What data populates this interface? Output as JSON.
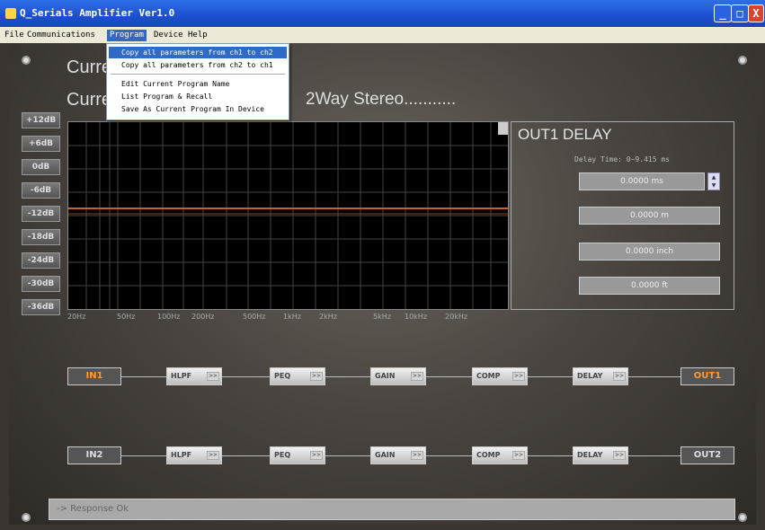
{
  "window": {
    "title": "Q_Serials Amplifier Ver1.0",
    "buttons": {
      "minimize": "_",
      "maximize": "□",
      "close": "X"
    }
  },
  "menu": {
    "items": [
      "File",
      "Communications",
      "Program",
      "Device",
      "Help"
    ],
    "active": "Program"
  },
  "program_menu": {
    "items": [
      "Copy all parameters from ch1 to ch2",
      "Copy all parameters from ch2 to ch1",
      "Edit Current Program Name",
      "List Program & Recall",
      "Save As Current Program In Device"
    ]
  },
  "header": {
    "current_label_1": "Curre",
    "current_label_2": "Curre",
    "program_name": "2Way Stereo..........."
  },
  "gain_buttons": [
    "+12dB",
    "+6dB",
    "0dB",
    "-6dB",
    "-12dB",
    "-18dB",
    "-24dB",
    "-30dB",
    "-36dB"
  ],
  "frequency_labels": [
    "20Hz",
    "50Hz",
    "100Hz",
    "200Hz",
    "500Hz",
    "1kHz",
    "2kHz",
    "5kHz",
    "10kHz",
    "20kHz"
  ],
  "delay": {
    "title": "OUT1 DELAY",
    "hint": "Delay Time: 0~9.415 ms",
    "ms": "0.0000 ms",
    "m": "0.0000 m",
    "inch": "0.0000 inch",
    "ft": "0.0000 ft"
  },
  "chain1": {
    "input": "IN1",
    "output": "OUT1",
    "modules": [
      "HLPF",
      "PEQ",
      "GAIN",
      "COMP",
      "DELAY"
    ]
  },
  "chain2": {
    "input": "IN2",
    "output": "OUT2",
    "modules": [
      "HLPF",
      "PEQ",
      "GAIN",
      "COMP",
      "DELAY"
    ]
  },
  "module_arrow": ">>",
  "status": "-> Response Ok",
  "colors": {
    "accent_orange": "#ff9a30",
    "title_bar": "#1c4fd0",
    "response_curve": "#c8641e"
  }
}
